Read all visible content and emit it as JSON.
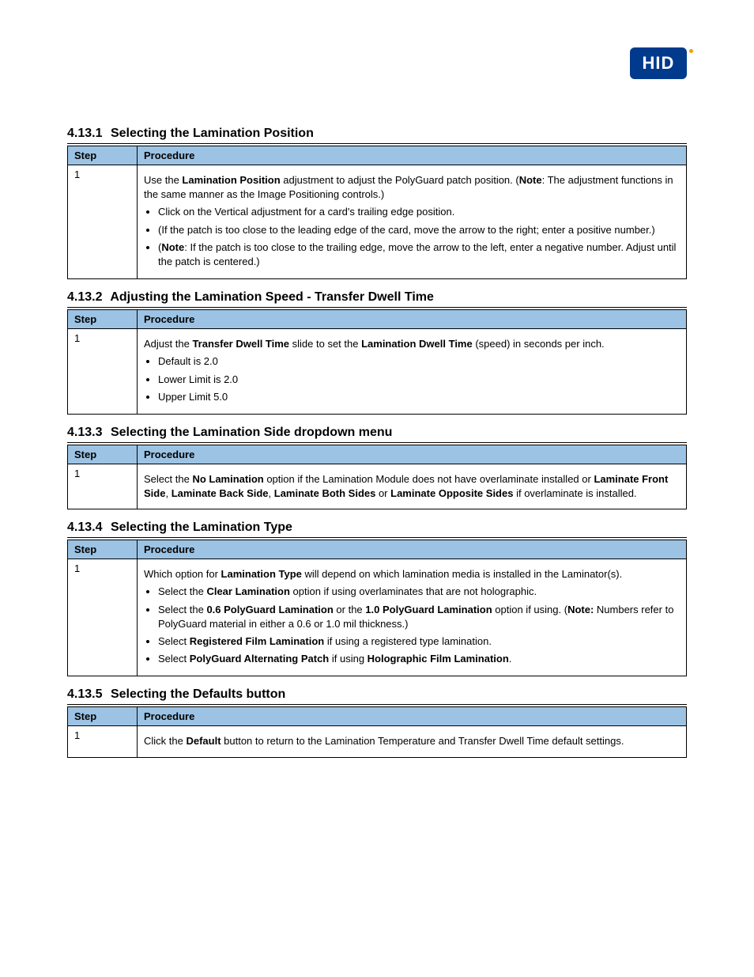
{
  "logo_text": "HID",
  "table_headers": {
    "step": "Step",
    "procedure": "Procedure"
  },
  "s1": {
    "num": "4.13.1",
    "title": "Selecting the Lamination Position",
    "step": "1",
    "intro_a": "Use the ",
    "intro_b": "Lamination Position",
    "intro_c": " adjustment to adjust the PolyGuard patch position. (",
    "intro_d": "Note",
    "intro_e": ": The adjustment functions in the same manner as the Image Positioning controls.)",
    "b1": "Click on the Vertical adjustment for a card's trailing edge position.",
    "b2a": "(If the patch is too close to the leading edge of the card, move the arrow to the right; ",
    "b2b": "enter a positive number.)",
    "b3a": "(",
    "b3b": "Note",
    "b3c": ": If the patch is too close to the trailing edge, move the arrow to the left, enter a ",
    "b3d": "negative number. Adjust until the patch is centered.)"
  },
  "s2": {
    "num": "4.13.2",
    "title": "Adjusting the Lamination Speed - Transfer Dwell Time",
    "step": "1",
    "intro_a": "Adjust the ",
    "intro_b": "Transfer Dwell Time",
    "intro_c": " slide to set the ",
    "intro_d": "Lamination Dwell Time",
    "intro_e": " (speed) in seconds ",
    "intro_f": "per inch.",
    "b1": "Default is 2.0",
    "b2": "Lower Limit is 2.0",
    "b3": "Upper Limit 5.0"
  },
  "s3": {
    "num": "4.13.3",
    "title": "Selecting the Lamination Side dropdown menu",
    "step": "1",
    "l1a": "Select the ",
    "l1b": "No Lamination",
    "l1c": " option if the Lamination Module does not have overlaminate ",
    "l2a": "installed or ",
    "l2b": "Laminate Front Side",
    "l2c": ", ",
    "l2d": "Laminate Back Side",
    "l2e": ", ",
    "l2f": "Laminate Both Sides",
    "l2g": " or ",
    "l2h": "Laminate ",
    "l3a": "Opposite Sides",
    "l3b": " if overlaminate is installed."
  },
  "s4": {
    "num": "4.13.4",
    "title": "Selecting the Lamination Type",
    "step": "1",
    "intro_a": "Which option for ",
    "intro_b": "Lamination Type",
    "intro_c": " will depend on which lamination media is installed in the ",
    "intro_d": "Laminator(s).",
    "b1a": "Select the ",
    "b1b": "Clear Lamination",
    "b1c": " option if using overlaminates that are not ",
    "b1d": "holographic.",
    "b2a": "Select the ",
    "b2b": "0.6 PolyGuard Lamination",
    "b2c": " or the ",
    "b2d": "1.0 PolyGuard Lamination",
    "b2e": " option if ",
    "b2f": "using. (",
    "b2g": "Note:",
    "b2h": " Numbers refer to PolyGuard material in either a 0.6 or 1.0 mil ",
    "b2i": "thickness.)",
    "b3a": "Select ",
    "b3b": "Registered Film Lamination",
    "b3c": " if using a registered type lamination.",
    "b4a": "Select ",
    "b4b": "PolyGuard Alternating Patch",
    "b4c": " if using ",
    "b4d": "Holographic Film Lamination",
    "b4e": "."
  },
  "s5": {
    "num": "4.13.5",
    "title": "Selecting the Defaults button",
    "step": "1",
    "l1a": "Click the ",
    "l1b": "Default",
    "l1c": " button to return to the Lamination Temperature and Transfer Dwell Time ",
    "l2": "default settings."
  }
}
